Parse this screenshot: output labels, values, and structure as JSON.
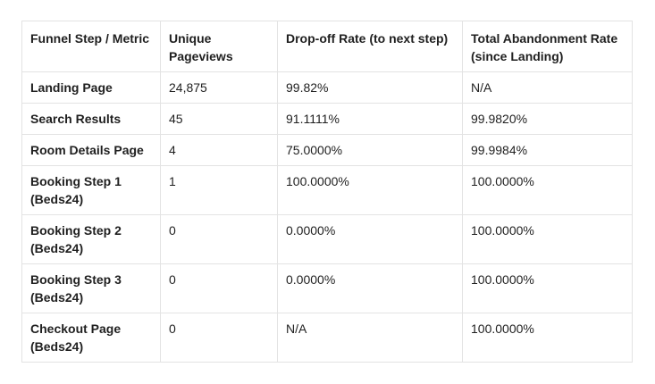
{
  "table": {
    "headers": [
      "Funnel Step / Metric",
      "Unique Pageviews",
      "Drop-off Rate (to next step)",
      "Total Abandonment Rate (since Landing)"
    ],
    "rows": [
      [
        "Landing Page",
        "24,875",
        "99.82%",
        "N/A"
      ],
      [
        "Search Results",
        "45",
        "91.1111%",
        "99.9820%"
      ],
      [
        "Room Details Page",
        "4",
        "75.0000%",
        "99.9984%"
      ],
      [
        "Booking Step 1 (Beds24)",
        "1",
        "100.0000%",
        "100.0000%"
      ],
      [
        "Booking Step 2 (Beds24)",
        "0",
        "0.0000%",
        "100.0000%"
      ],
      [
        "Booking Step 3 (Beds24)",
        "0",
        "0.0000%",
        "100.0000%"
      ],
      [
        "Checkout Page (Beds24)",
        "0",
        "N/A",
        "100.0000%"
      ]
    ]
  }
}
